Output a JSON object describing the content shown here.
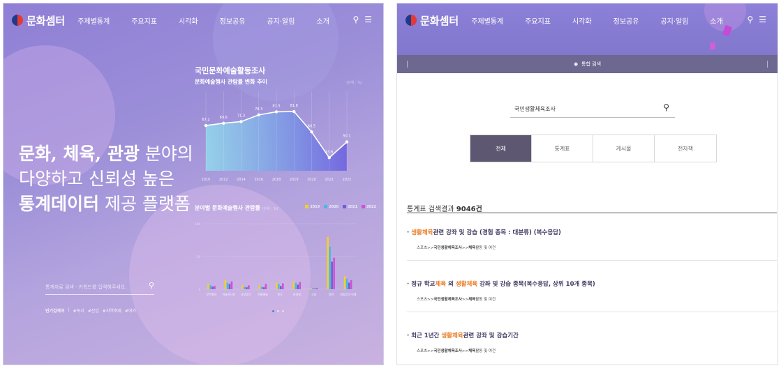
{
  "left": {
    "logo": "문화셈터",
    "menu": [
      "주제별통계",
      "주요지표",
      "시각화",
      "정보공유",
      "공지·알림",
      "소개"
    ],
    "headline": {
      "line1_bold": "문화, 체육, 관광",
      "line1_rest": " 분야의",
      "line2": "다양하고 신뢰성 높은",
      "line3_bold": "통계데이터",
      "line3_rest": " 제공 플랫폼"
    },
    "search_placeholder": "통계자료 검색 · 키워드를 입력해주세요.",
    "popular_label": "인기검색어",
    "popular_items": [
      "#독서",
      "#산업",
      "#지역축제",
      "#여가"
    ],
    "chart1": {
      "title": "국민문화예술활동조사",
      "subtitle": "문화예술행사 관람률 변화 추이",
      "unit": "(단위 : %)"
    },
    "chart2": {
      "title": "분야별 문화예술행사 관람률",
      "unit": "(단위 : %)",
      "legend": [
        "2019",
        "2020",
        "2021",
        "2022"
      ]
    }
  },
  "right": {
    "logo": "문화셈터",
    "menu": [
      "주제별통계",
      "주요지표",
      "시각화",
      "정보공유",
      "공지·알림",
      "소개"
    ],
    "bar_label": "통합 검색",
    "search_value": "국민생활체육조사",
    "tabs": [
      "전체",
      "통계표",
      "게시물",
      "전자책"
    ],
    "result_count_label": "통계표 검색결과",
    "result_count": "9046건",
    "results": [
      {
        "pre": "",
        "hl1": "생활체육",
        "mid": "관련 강좌 및 강습 (경험 종목 : 대분류) (복수응답)",
        "hl2": "",
        "post": "",
        "path_a": "스포츠>>",
        "path_b": "국민생활체육조사",
        "path_c": ">>",
        "path_d": "체육",
        "path_e": "활동 및 여건"
      },
      {
        "pre": "정규 학교",
        "hl1": "체육",
        "mid": " 외 ",
        "hl2": "생활체육",
        "post": " 강좌 및 강습 종목(복수응답, 상위 10개 종목)",
        "path_a": "스포츠>>",
        "path_b": "국민생활체육조사",
        "path_c": ">>",
        "path_d": "체육",
        "path_e": "활동 및 여건"
      },
      {
        "pre": "최근 1년간 ",
        "hl1": "생활체육",
        "mid": "관련 강좌 및 강습기간",
        "hl2": "",
        "post": "",
        "path_a": "스포츠>>",
        "path_b": "국민생활체육조사",
        "path_c": ">>",
        "path_d": "체육",
        "path_e": "활동 및 여건"
      }
    ]
  },
  "chart_data": [
    {
      "type": "area",
      "title": "문화예술행사 관람률 변화 추이",
      "x": [
        "2010",
        "2012",
        "2014",
        "2016",
        "2018",
        "2019",
        "2020",
        "2021",
        "2022"
      ],
      "values": [
        67.2,
        69.6,
        71.3,
        78.3,
        81.5,
        81.8,
        60.5,
        33.6,
        50.1
      ],
      "ylim": [
        20,
        100
      ]
    },
    {
      "type": "bar",
      "title": "분야별 문화예술행사 관람률",
      "categories": [
        "문학행사",
        "미술전시회",
        "서양음악",
        "전통예술",
        "연극",
        "뮤지컬",
        "무용",
        "영화",
        "대중음악·연예"
      ],
      "ylim": [
        0,
        100
      ],
      "yticks": [
        0,
        50,
        100
      ],
      "series": [
        {
          "name": "2019",
          "color": "#f2d02a",
          "values": [
            8,
            14,
            6,
            6,
            10,
            12,
            2,
            80,
            20
          ]
        },
        {
          "name": "2020",
          "color": "#47b9e6",
          "values": [
            6,
            10,
            4,
            4,
            8,
            10,
            2,
            65,
            16
          ]
        },
        {
          "name": "2021",
          "color": "#6d5ed6",
          "values": [
            4,
            8,
            3,
            3,
            5,
            7,
            1,
            42,
            10
          ]
        },
        {
          "name": "2022",
          "color": "#d34fd6",
          "values": [
            5,
            12,
            6,
            8,
            9,
            11,
            2,
            48,
            14
          ]
        }
      ]
    }
  ]
}
